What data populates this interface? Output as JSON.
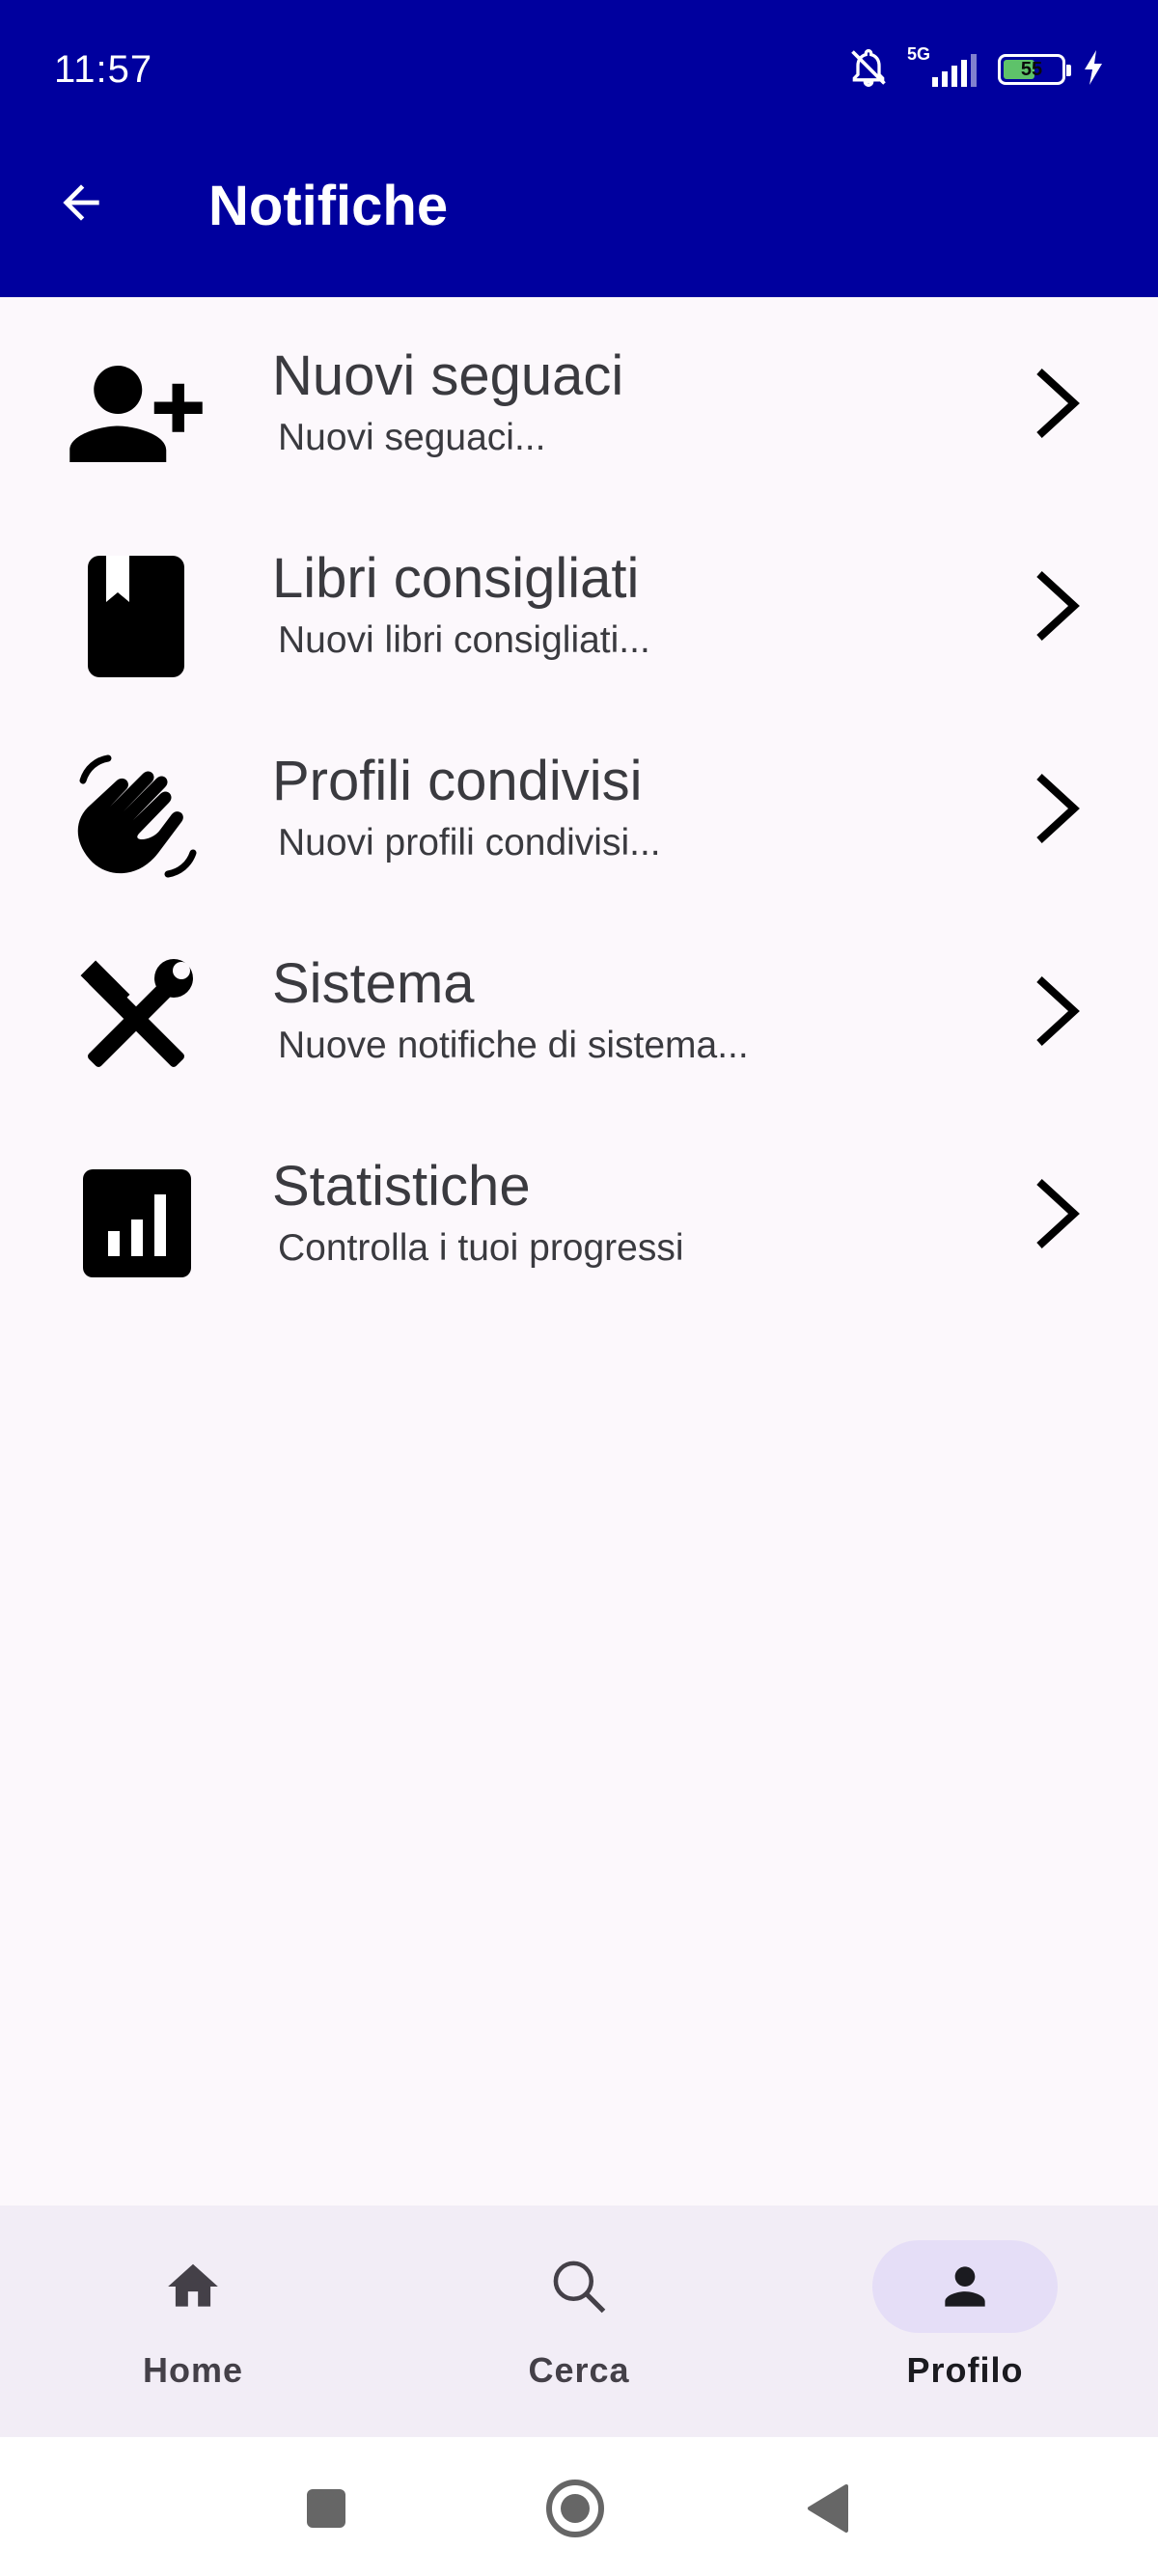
{
  "status_bar": {
    "time": "11:57",
    "network_label": "5G",
    "battery_percent": "55",
    "battery_level": 0.55,
    "icons": [
      "bell-off-icon",
      "signal-icon",
      "battery-icon",
      "charging-icon"
    ]
  },
  "app_bar": {
    "title": "Notifiche",
    "background_color": "#00009e"
  },
  "items": [
    {
      "title": "Nuovi seguaci",
      "subtitle": "Nuovi seguaci...",
      "icon": "person-add-icon"
    },
    {
      "title": "Libri consigliati",
      "subtitle": "Nuovi libri consigliati...",
      "icon": "book-icon"
    },
    {
      "title": "Profili condivisi",
      "subtitle": "Nuovi profili condivisi...",
      "icon": "waving-hand-icon"
    },
    {
      "title": "Sistema",
      "subtitle": "Nuove notifiche di sistema...",
      "icon": "tools-icon"
    },
    {
      "title": "Statistiche",
      "subtitle": "Controlla i tuoi progressi",
      "icon": "bar-chart-icon"
    }
  ],
  "bottom_nav": {
    "items": [
      {
        "label": "Home",
        "icon": "home-icon",
        "active": false
      },
      {
        "label": "Cerca",
        "icon": "search-icon",
        "active": false
      },
      {
        "label": "Profilo",
        "icon": "person-icon",
        "active": true
      }
    ],
    "active_pill_color": "#e5def7"
  }
}
